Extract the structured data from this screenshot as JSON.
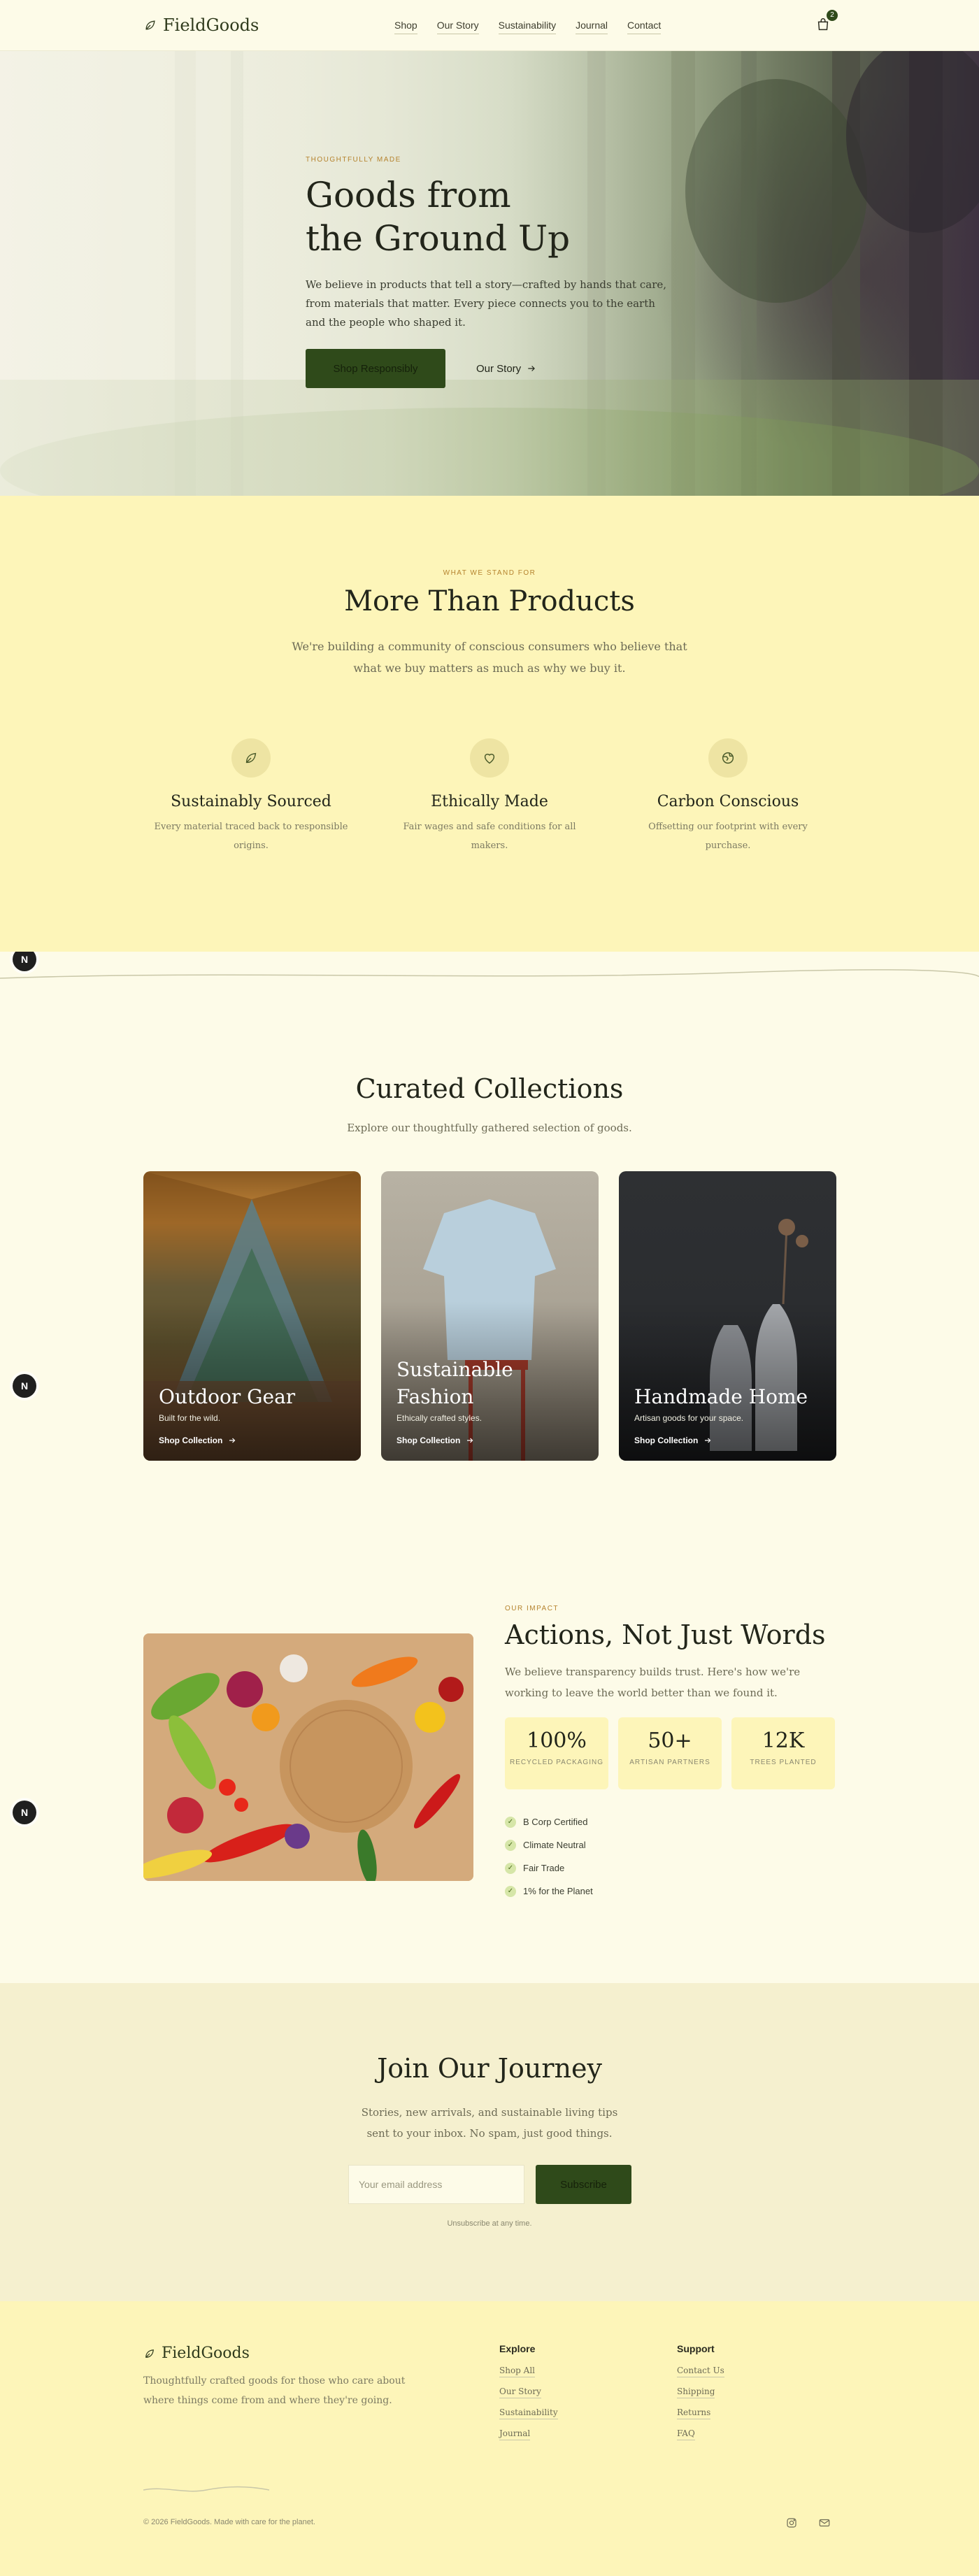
{
  "nav": {
    "brand": "FieldGoods",
    "links": [
      "Shop",
      "Our Story",
      "Sustainability",
      "Journal",
      "Contact"
    ],
    "cart_count": "2"
  },
  "hero": {
    "eyebrow": "THOUGHTFULLY MADE",
    "title_line1": "Goods from",
    "title_line2": "the Ground Up",
    "body": "We believe in products that tell a story—crafted by hands that care, from materials that matter. Every piece connects you to the earth and the people who shaped it.",
    "primary_cta": "Shop Responsibly",
    "secondary_cta": "Our Story"
  },
  "side_node_label": "N",
  "values": {
    "eyebrow": "WHAT WE STAND FOR",
    "title": "More Than Products",
    "subtitle": "We're building a community of conscious consumers who believe that what we buy matters as much as why we buy it.",
    "items": [
      {
        "title": "Sustainably Sourced",
        "text": "Every material traced back to responsible origins.",
        "icon": "leaf-icon"
      },
      {
        "title": "Ethically Made",
        "text": "Fair wages and safe conditions for all makers.",
        "icon": "heart-icon"
      },
      {
        "title": "Carbon Conscious",
        "text": "Offsetting our footprint with every purchase.",
        "icon": "globe-icon"
      }
    ]
  },
  "collections": {
    "title": "Curated Collections",
    "subtitle": "Explore our thoughtfully gathered selection of goods.",
    "cards": [
      {
        "title": "Outdoor Gear",
        "tag": "Built for the wild.",
        "cta": "Shop Collection"
      },
      {
        "title": "Sustainable Fashion",
        "tag": "Ethically crafted styles.",
        "cta": "Shop Collection"
      },
      {
        "title": "Handmade Home",
        "tag": "Artisan goods for your space.",
        "cta": "Shop Collection"
      }
    ]
  },
  "impact": {
    "eyebrow": "OUR IMPACT",
    "title": "Actions, Not Just Words",
    "body": "We believe transparency builds trust. Here's how we're working to leave the world better than we found it.",
    "stats": [
      {
        "num": "100%",
        "label": "RECYCLED PACKAGING"
      },
      {
        "num": "50+",
        "label": "ARTISAN PARTNERS"
      },
      {
        "num": "12K",
        "label": "TREES PLANTED"
      }
    ],
    "checks": [
      "B Corp Certified",
      "Climate Neutral",
      "Fair Trade",
      "1% for the Planet"
    ]
  },
  "newsletter": {
    "title": "Join Our Journey",
    "subtitle": "Stories, new arrivals, and sustainable living tips sent to your inbox. No spam, just good things.",
    "placeholder": "Your email address",
    "button": "Subscribe",
    "fine": "Unsubscribe at any time."
  },
  "footer": {
    "brand": "FieldGoods",
    "tagline": "Thoughtfully crafted goods for those who care about where things come from and where they're going.",
    "explore_title": "Explore",
    "explore_links": [
      "Shop All",
      "Our Story",
      "Sustainability",
      "Journal"
    ],
    "support_title": "Support",
    "support_links": [
      "Contact Us",
      "Shipping",
      "Returns",
      "FAQ"
    ],
    "copyright": "© 2026 FieldGoods. Made with care for the planet."
  },
  "colors": {
    "accent": "#2f4a1a",
    "eyebrow": "#b5832e",
    "cream": "#fdfbe8",
    "butter": "#fdf5b9"
  }
}
